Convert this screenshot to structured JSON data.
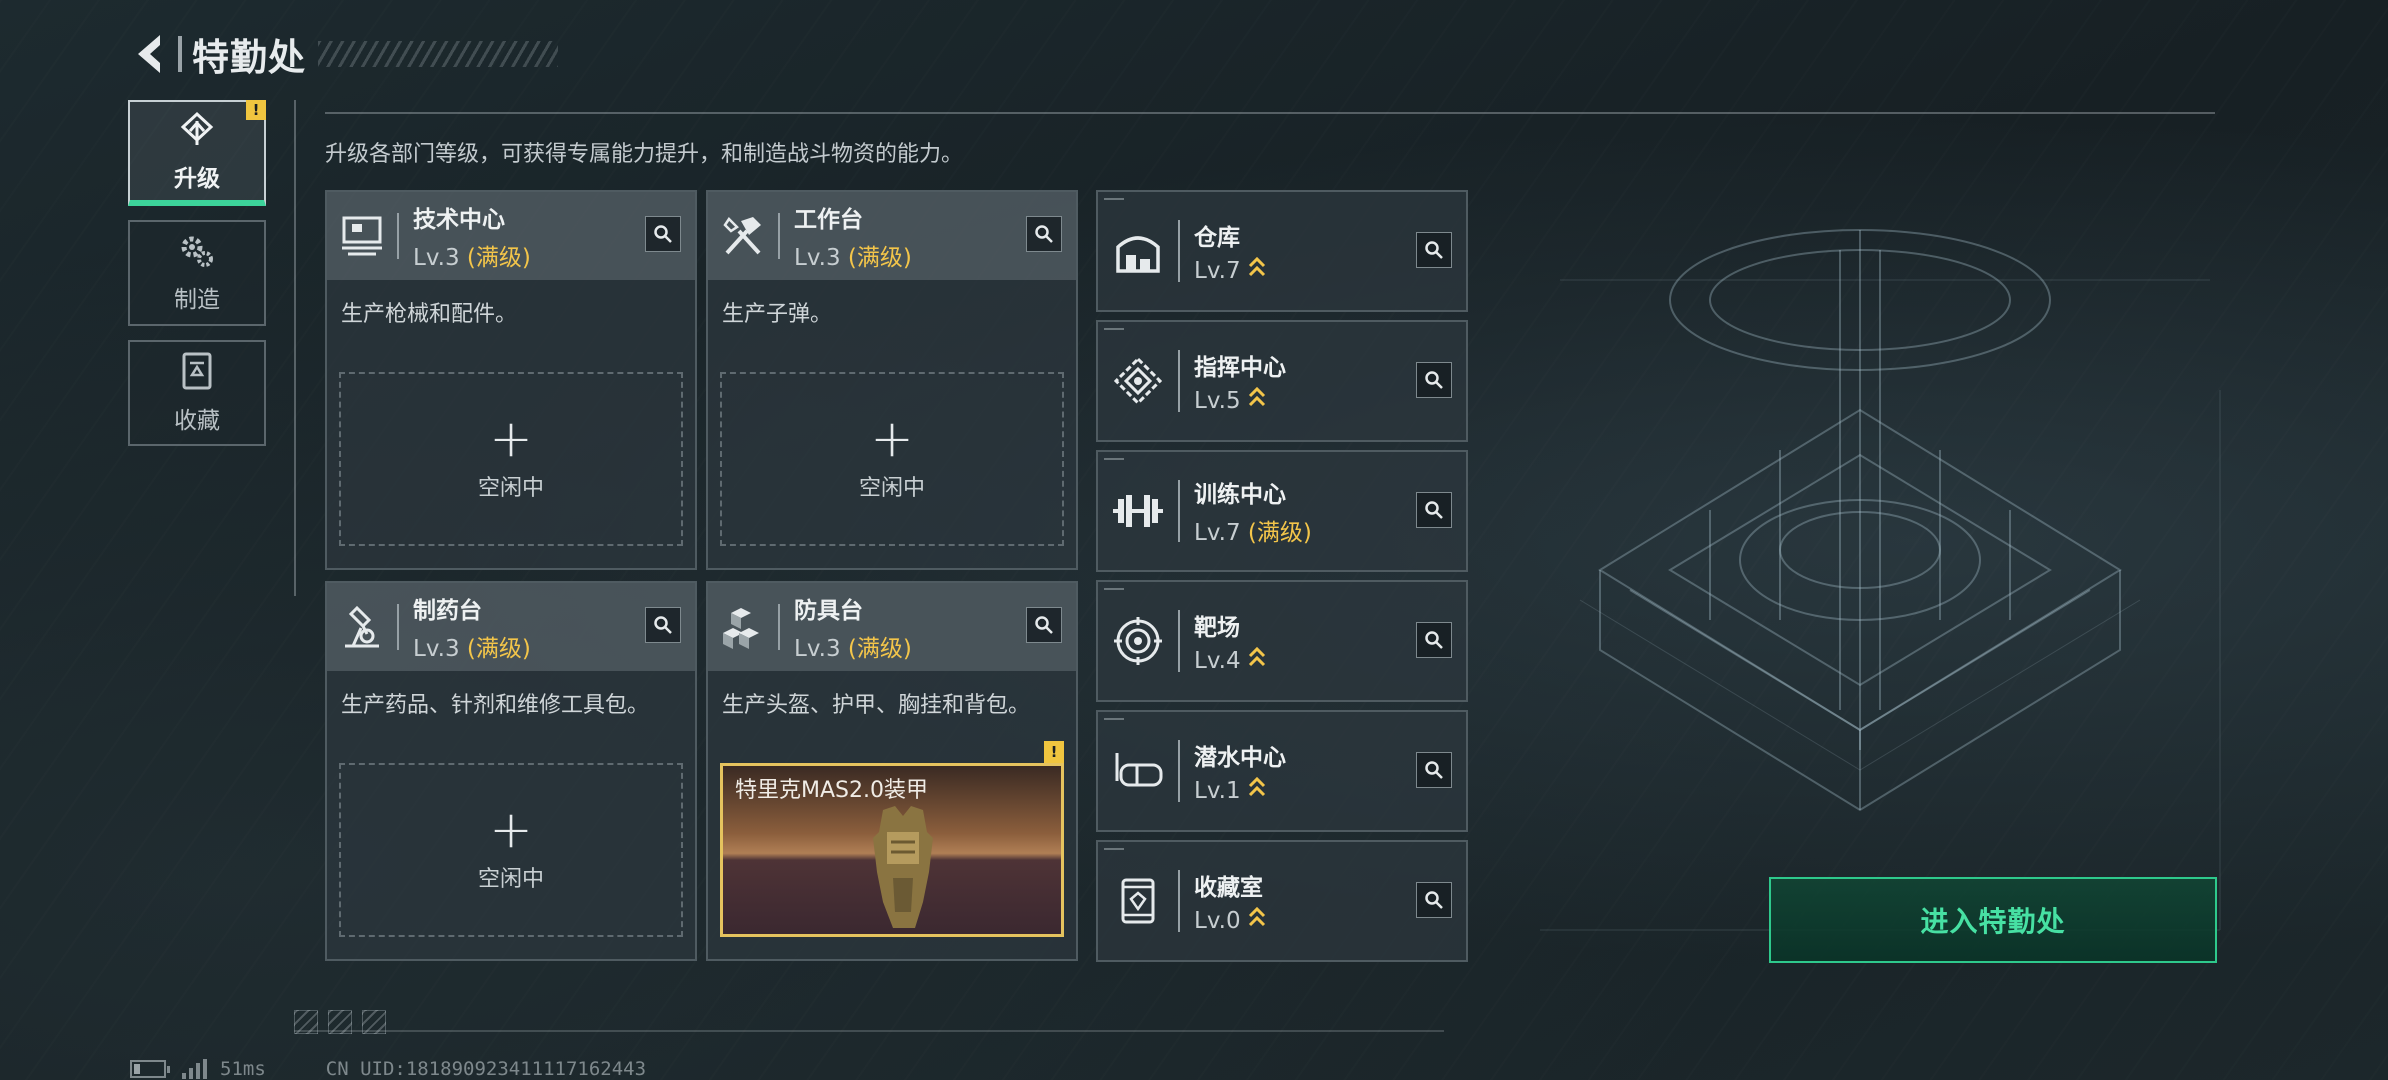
{
  "header": {
    "title": "特勤处"
  },
  "nav": {
    "items": [
      {
        "label": "升级",
        "icon": "upgrade-icon",
        "active": true,
        "badge": "!"
      },
      {
        "label": "制造",
        "icon": "gears-icon",
        "active": false
      },
      {
        "label": "收藏",
        "icon": "collection-icon",
        "active": false
      }
    ]
  },
  "subtitle": "升级各部门等级，可获得专属能力提升，和制造战斗物资的能力。",
  "cards": [
    {
      "name": "技术中心",
      "level": "Lv.3",
      "max": "(满级)",
      "desc": "生产枪械和配件。",
      "slot_status": "空闲中",
      "icon": "tech-center-icon"
    },
    {
      "name": "工作台",
      "level": "Lv.3",
      "max": "(满级)",
      "desc": "生产子弹。",
      "slot_status": "空闲中",
      "icon": "workbench-icon"
    },
    {
      "name": "制药台",
      "level": "Lv.3",
      "max": "(满级)",
      "desc": "生产药品、针剂和维修工具包。",
      "slot_status": "空闲中",
      "icon": "pharmacy-icon"
    },
    {
      "name": "防具台",
      "level": "Lv.3",
      "max": "(满级)",
      "desc": "生产头盔、护甲、胸挂和背包。",
      "slot_item": "特里克MAS2.0装甲",
      "slot_badge": "!",
      "icon": "armor-bench-icon"
    }
  ],
  "small_cards": [
    {
      "name": "仓库",
      "level": "Lv.7",
      "max": "",
      "upgradable": true,
      "icon": "warehouse-icon"
    },
    {
      "name": "指挥中心",
      "level": "Lv.5",
      "max": "",
      "upgradable": true,
      "icon": "command-center-icon"
    },
    {
      "name": "训练中心",
      "level": "Lv.7",
      "max": "(满级)",
      "upgradable": false,
      "icon": "training-center-icon"
    },
    {
      "name": "靶场",
      "level": "Lv.4",
      "max": "",
      "upgradable": true,
      "icon": "shooting-range-icon"
    },
    {
      "name": "潜水中心",
      "level": "Lv.1",
      "max": "",
      "upgradable": true,
      "icon": "diving-center-icon"
    },
    {
      "name": "收藏室",
      "level": "Lv.0",
      "max": "",
      "upgradable": true,
      "icon": "collection-room-icon"
    }
  ],
  "enter_button": "进入特勤处",
  "footer": {
    "ping": "51ms",
    "uid": "CN UID:181890923411117162443"
  },
  "colors": {
    "accent_green": "#2ec98c",
    "max_gold": "#f3c54a",
    "badge_yellow": "#f0c53f"
  }
}
